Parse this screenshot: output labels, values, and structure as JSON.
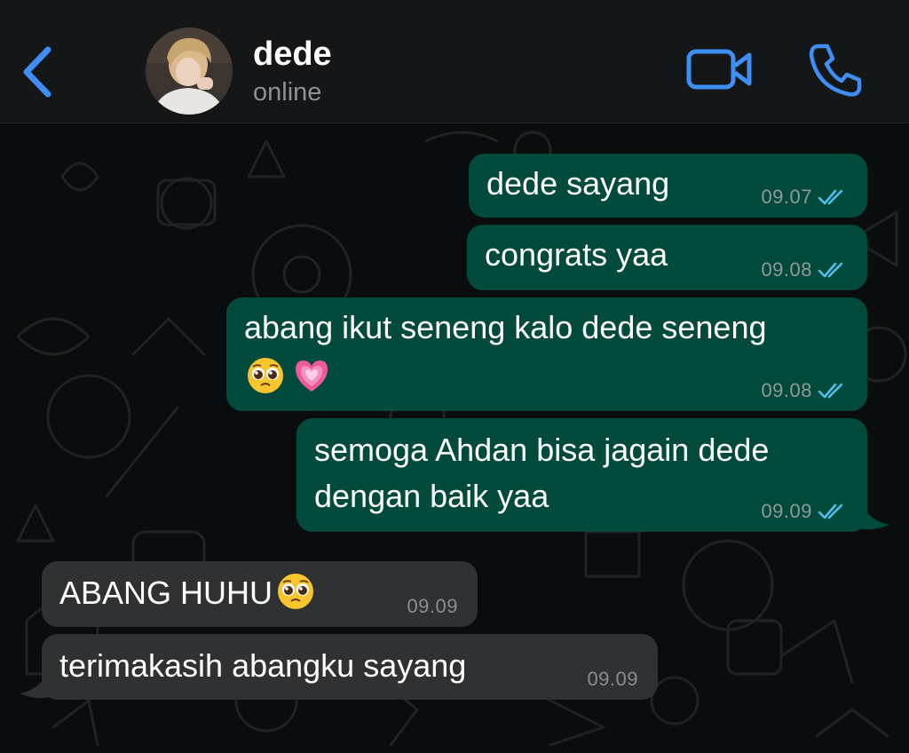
{
  "header": {
    "contact_name": "dede",
    "contact_status": "online",
    "accent_color": "#3e8ef3"
  },
  "icons": {
    "back": "chevron-left-icon",
    "video": "video-camera-icon",
    "call": "phone-icon",
    "read_receipt": "double-check-icon",
    "emoji_pleading": "pleading-face-emoji",
    "emoji_heart": "growing-heart-emoji"
  },
  "messages": [
    {
      "direction": "outgoing",
      "text": "dede sayang",
      "time": "09.07",
      "read": true
    },
    {
      "direction": "outgoing",
      "text": "congrats yaa",
      "time": "09.08",
      "read": true
    },
    {
      "direction": "outgoing",
      "text": "abang ikut seneng kalo dede seneng",
      "emojis": [
        "pleading-face",
        "growing-heart"
      ],
      "time": "09.08",
      "read": true
    },
    {
      "direction": "outgoing",
      "text_line1": "semoga Ahdan bisa jagain dede",
      "text_line2": "dengan baik yaa",
      "time": "09.09",
      "read": true
    },
    {
      "direction": "incoming",
      "text": "ABANG HUHU",
      "emojis": [
        "pleading-face"
      ],
      "time": "09.09"
    },
    {
      "direction": "incoming",
      "text": "terimakasih abangku sayang",
      "time": "09.09"
    }
  ],
  "colors": {
    "outgoing_bubble": "#024b3c",
    "incoming_bubble": "#2f3133",
    "header_bg": "#151617",
    "chat_bg": "#0b0c0d",
    "tick_blue": "#53bdeb"
  }
}
